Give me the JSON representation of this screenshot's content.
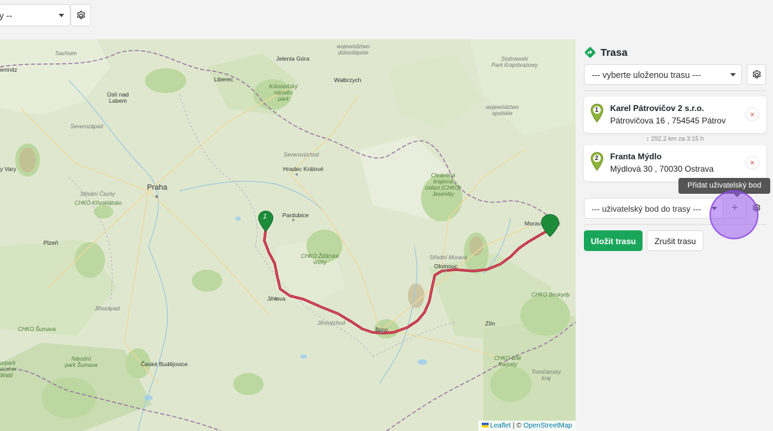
{
  "top": {
    "select_value": "y --"
  },
  "map": {
    "labels": {
      "sachsen": "Sachsen",
      "chemnitz": "emnitz",
      "usti": "Ústí nad\nLabem",
      "severozapad": "Severozápad",
      "vary": "y Vary",
      "praha": "Praha",
      "stredni_cechy": "Střední Čechy",
      "chko_krivoklatsko": "CHKO Křivoklátsko",
      "plzen": "Plzeň",
      "jihozapad": "Jihozápad",
      "chko_sumava": "CHKO Šumava",
      "narodni_park_sumava": "Národní\npark Šumava",
      "park_sumava_de": "urpark\nrischer\nWald",
      "ceske_budejovice": "České Budějovice",
      "liberec": "Liberec",
      "krkonossky": "Krkonošský\nnárodní\npark",
      "jelenia_gora": "Jelenia Góra",
      "dolnoslaskie": "województwo\ndolnośląskie",
      "walbrzych": "Wałbrzych",
      "severovychod": "Severovýchod",
      "hradec": "Hradec Králové",
      "pardubice": "Pardubice",
      "chko_zdarske": "CHKO Žďárské\nvrchy",
      "jihlava": "Jihlava",
      "jihovychod": "Jihovýchod",
      "brno": "Brno",
      "stredni_morava": "Střední Morava",
      "olomouc": "Olomouc",
      "zlin": "Zlín",
      "chko_beskydy": "CHKO Beskydy",
      "chko_bile_karpaty": "CHKO Bílé\nKarpaty",
      "trenciansky": "Trenčiansky\nkraj",
      "jeseniky": "Chráněná\nkrajinná\noblast (CHKO)\nJeseníky",
      "opolskie": "województwo\nopolskie",
      "stobrawski": "Stobrawski\nPark Krajobrazowy",
      "moravskoslezsky": "Moravskoslez"
    },
    "attribution": {
      "leaflet": "Leaflet",
      "separator": " | © ",
      "osm": "OpenStreetMap"
    },
    "markers": [
      {
        "number": "1",
        "color": "#1c8c3a"
      },
      {
        "number": "",
        "color": "#1c8c3a"
      }
    ],
    "route_color": "#b5122b"
  },
  "panel": {
    "title": "Trasa",
    "saved_route_select": "--- vyberte uloženou trasu ---",
    "waypoints": [
      {
        "number": "1",
        "name": "Karel Pátrovičov 2 s.r.o.",
        "address": "Pátrovičova 16 , 754545 Pátrov"
      },
      {
        "number": "2",
        "name": "Franta Mýdlo",
        "address": "Mýdlová 30 , 70030 Ostrava"
      }
    ],
    "leg_info": "292,2 km za 3:15 h",
    "custom_point_select": "--- uživatelský bod do trasy ---",
    "plus_label": "+",
    "tooltip": "Přidat uživatelský bod",
    "save_button": "Uložit trasu",
    "cancel_button": "Zrušit trasu",
    "remove_label": "×"
  },
  "colors": {
    "accent": "#1aa65a",
    "map_background": "#dfe8cf",
    "route": "#b5122b"
  }
}
